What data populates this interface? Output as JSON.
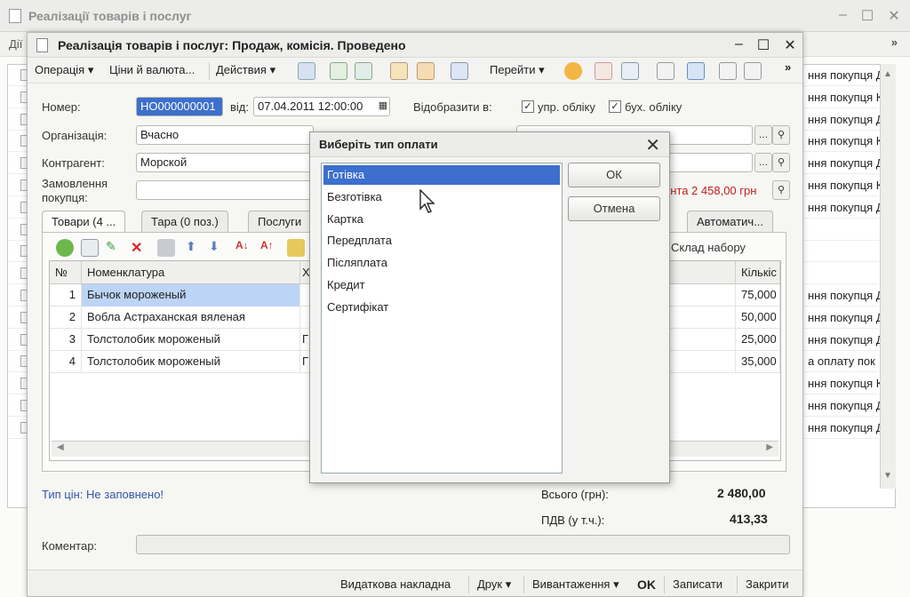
{
  "background_window": {
    "title": "Реалізації товарів і послуг",
    "menu_first": "Дії",
    "rows": [
      "ння покупця Д",
      "ння покупця К",
      "ння покупця Д",
      "ння покупця К",
      "ння покупця Д",
      "ння покупця К",
      "ння покупця Д",
      "",
      "",
      "",
      "ння покупця Д",
      "ння покупця Д",
      "ння покупця Д",
      "а оплату пок",
      "ння покупця К",
      "ння покупця Д",
      "ння покупця Д"
    ]
  },
  "document_window": {
    "title": "Реалізація товарів і послуг: Продаж, комісія. Проведено",
    "toolbar": {
      "operation": "Операція",
      "prices": "Ціни й валюта...",
      "actions": "Действия",
      "goto": "Перейти"
    },
    "number_label": "Номер:",
    "number_value": "НО000000001",
    "date_label": "від:",
    "date_value": "07.04.2011 12:00:00",
    "reflect_label": "Відобразити в:",
    "mgmt_accounting": "упр. обліку",
    "acc_accounting": "бух. обліку",
    "organization_label": "Організація:",
    "organization_value": "Вчасно",
    "contractor_label": "Контрагент:",
    "contractor_value": "Морской",
    "order_label_1": "Замовлення",
    "order_label_2": "покупця:",
    "debt_text": "ента 2 458,00 грн",
    "tabs": {
      "goods": "Товари (4 ...",
      "tara": "Тара (0 поз.)",
      "services": "Послуги",
      "auto": "Автоматич..."
    },
    "warehouse_label": "Склад набору",
    "grid": {
      "col_num": "№",
      "col_name": "Номенклатура",
      "col_char": "Х",
      "col_qty": "Кількіс",
      "rows": [
        {
          "num": "1",
          "name": "Бычок мороженый",
          "char": "",
          "qty": "75,000"
        },
        {
          "num": "2",
          "name": "Вобла Астраханская вяленая",
          "char": "",
          "qty": "50,000"
        },
        {
          "num": "3",
          "name": "Толстолобик мороженый",
          "char": "Г",
          "qty": "25,000"
        },
        {
          "num": "4",
          "name": "Толстолобик мороженый",
          "char": "Г",
          "qty": "35,000"
        }
      ]
    },
    "price_type": "Тип цін: Не заповнено!",
    "total_label": "Всього (грн):",
    "total_value": "2 480,00",
    "vat_label": "ПДВ (у т.ч.):",
    "vat_value": "413,33",
    "comment_label": "Коментар:",
    "bottom": {
      "invoice": "Видаткова накладна",
      "print": "Друк",
      "export": "Вивантаження",
      "ok": "OK",
      "save": "Записати",
      "close": "Закрити"
    }
  },
  "dialog": {
    "title": "Виберіть тип оплати",
    "options": [
      "Готівка",
      "Безготівка",
      "Картка",
      "Передплата",
      "Післяплата",
      "Кредит",
      "Сертифікат"
    ],
    "selected_index": 0,
    "ok": "ОК",
    "cancel": "Отмена"
  }
}
